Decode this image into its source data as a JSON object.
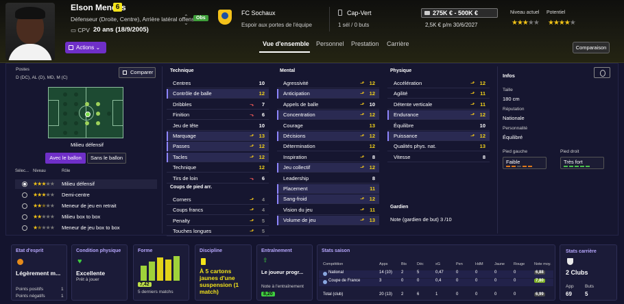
{
  "header": {
    "name": "Elson Mendes",
    "number": "6",
    "positions": "Défenseur (Droite, Centre), Arrière latéral offensif ...",
    "obs_badge": "Obs",
    "cpv": "CPV",
    "age": "20 ans (18/9/2005)",
    "club": "FC Sochaux",
    "club_sub": "Espoir aux portes de l'équipe",
    "nation": "Cap-Vert",
    "caps": "1 sél / 0 buts",
    "value": "275K € - 500K €",
    "wage": "2,5K € p/m 30/6/2027",
    "current_level_label": "Niveau actuel",
    "potential_label": "Potentiel",
    "current_level_stars": 3,
    "potential_stars": 4,
    "actions_label": "Actions",
    "comparison_label": "Comparaison"
  },
  "tabs": [
    "Vue d'ensemble",
    "Personnel",
    "Prestation",
    "Carrière"
  ],
  "positions_panel": {
    "label": "Postes",
    "value": "D (DC), AL (D), MD, M (C)",
    "compare_label": "Comparer",
    "role_label": "Milieu défensif",
    "with_ball": "Avec le ballon",
    "without_ball": "Sans le ballon",
    "headers": {
      "select": "Sélec...",
      "level": "Niveau",
      "role": "Rôle"
    },
    "roles": [
      {
        "stars": 3,
        "name": "Milieu défensif",
        "selected": true
      },
      {
        "stars": 3,
        "name": "Demi-centre",
        "selected": false
      },
      {
        "stars": 2.5,
        "name": "Meneur de jeu en retrait",
        "selected": false
      },
      {
        "stars": 2,
        "name": "Milieu box to box",
        "selected": false
      },
      {
        "stars": 1.5,
        "name": "Meneur de jeu box to box",
        "selected": false
      }
    ]
  },
  "attributes": {
    "technique_title": "Technique",
    "technique": [
      {
        "name": "Centres",
        "value": "10",
        "arrow": "",
        "color": "w",
        "hl": false
      },
      {
        "name": "Contrôle de balle",
        "value": "12",
        "arrow": "",
        "color": "y",
        "hl": true
      },
      {
        "name": "Dribbles",
        "value": "7",
        "arrow": "down",
        "color": "w",
        "hl": false
      },
      {
        "name": "Finition",
        "value": "6",
        "arrow": "down",
        "color": "w",
        "hl": false
      },
      {
        "name": "Jeu de tête",
        "value": "10",
        "arrow": "",
        "color": "w",
        "hl": false
      },
      {
        "name": "Marquage",
        "value": "13",
        "arrow": "up",
        "color": "y",
        "hl": true
      },
      {
        "name": "Passes",
        "value": "12",
        "arrow": "up",
        "color": "y",
        "hl": true
      },
      {
        "name": "Tacles",
        "value": "12",
        "arrow": "up",
        "color": "y",
        "hl": true
      },
      {
        "name": "Technique",
        "value": "12",
        "arrow": "",
        "color": "y",
        "hl": false
      },
      {
        "name": "Tirs de loin",
        "value": "6",
        "arrow": "down",
        "color": "w",
        "hl": false
      }
    ],
    "setpieces_title": "Coups de pied arr.",
    "setpieces": [
      {
        "name": "Corners",
        "value": "4",
        "arrow": "up",
        "color": "g",
        "hl": false
      },
      {
        "name": "Coups francs",
        "value": "4",
        "arrow": "up",
        "color": "g",
        "hl": false
      },
      {
        "name": "Penalty",
        "value": "5",
        "arrow": "up",
        "color": "g",
        "hl": false
      },
      {
        "name": "Touches longues",
        "value": "5",
        "arrow": "up",
        "color": "g",
        "hl": false
      }
    ],
    "mental_title": "Mental",
    "mental": [
      {
        "name": "Agressivité",
        "value": "12",
        "arrow": "up",
        "color": "y",
        "hl": false
      },
      {
        "name": "Anticipation",
        "value": "12",
        "arrow": "up",
        "color": "y",
        "hl": true
      },
      {
        "name": "Appels de balle",
        "value": "10",
        "arrow": "up",
        "color": "w",
        "hl": false
      },
      {
        "name": "Concentration",
        "value": "12",
        "arrow": "up",
        "color": "y",
        "hl": true
      },
      {
        "name": "Courage",
        "value": "13",
        "arrow": "",
        "color": "y",
        "hl": false
      },
      {
        "name": "Décisions",
        "value": "12",
        "arrow": "up",
        "color": "y",
        "hl": true
      },
      {
        "name": "Détermination",
        "value": "12",
        "arrow": "",
        "color": "y",
        "hl": false
      },
      {
        "name": "Inspiration",
        "value": "8",
        "arrow": "up",
        "color": "w",
        "hl": false
      },
      {
        "name": "Jeu collectif",
        "value": "12",
        "arrow": "up",
        "color": "y",
        "hl": true
      },
      {
        "name": "Leadership",
        "value": "8",
        "arrow": "",
        "color": "w",
        "hl": false
      },
      {
        "name": "Placement",
        "value": "11",
        "arrow": "",
        "color": "y",
        "hl": true
      },
      {
        "name": "Sang-froid",
        "value": "12",
        "arrow": "up",
        "color": "y",
        "hl": true
      },
      {
        "name": "Vision du jeu",
        "value": "11",
        "arrow": "up",
        "color": "y",
        "hl": false
      },
      {
        "name": "Volume de jeu",
        "value": "13",
        "arrow": "up",
        "color": "y",
        "hl": true
      }
    ],
    "physical_title": "Physique",
    "physical": [
      {
        "name": "Accélération",
        "value": "12",
        "arrow": "up",
        "color": "y",
        "hl": false
      },
      {
        "name": "Agilité",
        "value": "11",
        "arrow": "up",
        "color": "y",
        "hl": false
      },
      {
        "name": "Détente verticale",
        "value": "11",
        "arrow": "up",
        "color": "y",
        "hl": false
      },
      {
        "name": "Endurance",
        "value": "12",
        "arrow": "up",
        "color": "y",
        "hl": true
      },
      {
        "name": "Équilibre",
        "value": "10",
        "arrow": "",
        "color": "w",
        "hl": false
      },
      {
        "name": "Puissance",
        "value": "12",
        "arrow": "up",
        "color": "y",
        "hl": true
      },
      {
        "name": "Qualités phys. nat.",
        "value": "13",
        "arrow": "",
        "color": "y",
        "hl": false
      },
      {
        "name": "Vitesse",
        "value": "8",
        "arrow": "",
        "color": "w",
        "hl": false
      }
    ],
    "gk_title": "Gardien",
    "gk_row": "Note (gardien de but)  3 /10"
  },
  "info": {
    "title": "Infos",
    "height_label": "Taille",
    "height": "180 cm",
    "rep_label": "Réputation",
    "rep": "Nationale",
    "pers_label": "Personnalité",
    "pers": "Équilibré",
    "left_foot_label": "Pied gauche",
    "left_foot": "Faible",
    "right_foot_label": "Pied droit",
    "right_foot": "Très fort"
  },
  "cards": {
    "mood_title": "Etat d'esprit",
    "mood": "Légèrement m...",
    "mood_pos_label": "Points positifs",
    "mood_pos": "1",
    "mood_neg_label": "Points négatifs",
    "mood_neg": "1",
    "cond_title": "Condition physique",
    "cond": "Excellente",
    "cond_sub": "Prêt à jouer",
    "form_title": "Forme",
    "form_avg": "7,42",
    "form_sub": "5 derniers matchs",
    "form_bars": [
      55,
      70,
      85,
      78,
      90
    ],
    "disc_title": "Discipline",
    "disc": "À 5 cartons jaunes d'une suspension (1 match)",
    "train_title": "Entraînement",
    "train": "Le joueur progr...",
    "train_sub": "Note à l'entraînement",
    "train_val": "8,20",
    "stats_title": "Stats saison",
    "stats_headers": [
      "Compétition",
      "Apps",
      "Bts",
      "Déc",
      "xG",
      "Pen",
      "HdM",
      "Jaune",
      "Rouge",
      "Note moy."
    ],
    "stats_rows": [
      [
        "National",
        "14 (10)",
        "2",
        "5",
        "0,47",
        "0",
        "0",
        "0",
        "0",
        "6,88"
      ],
      [
        "Coupe de France",
        "3",
        "0",
        "0",
        "0,4",
        "0",
        "0",
        "0",
        "0",
        "7,80"
      ],
      [
        "Total (club)",
        "20 (13)",
        "2",
        "6",
        "1",
        "0",
        "0",
        "0",
        "0",
        "6,99"
      ]
    ],
    "career_title": "Stats carrière",
    "career_clubs": "2 Clubs",
    "career_apps_label": "App",
    "career_apps": "69",
    "career_goals_label": "Buts",
    "career_goals": "5"
  }
}
